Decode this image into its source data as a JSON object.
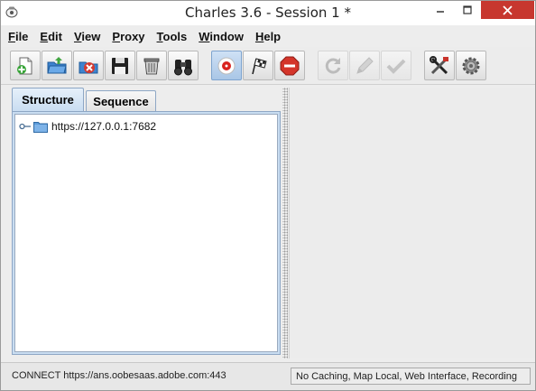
{
  "window": {
    "title": "Charles 3.6 - Session 1 *"
  },
  "menubar": {
    "items": [
      {
        "label": "File",
        "mnemonic": "F",
        "rest": "ile"
      },
      {
        "label": "Edit",
        "mnemonic": "E",
        "rest": "dit"
      },
      {
        "label": "View",
        "mnemonic": "V",
        "rest": "iew"
      },
      {
        "label": "Proxy",
        "mnemonic": "P",
        "rest": "roxy"
      },
      {
        "label": "Tools",
        "mnemonic": "T",
        "rest": "ools"
      },
      {
        "label": "Window",
        "mnemonic": "W",
        "rest": "indow"
      },
      {
        "label": "Help",
        "mnemonic": "H",
        "rest": "elp"
      }
    ]
  },
  "toolbar": {
    "buttons": [
      {
        "icon": "new-session-icon",
        "state": "enabled"
      },
      {
        "icon": "open-folder-icon",
        "state": "enabled"
      },
      {
        "icon": "close-session-icon",
        "state": "enabled"
      },
      {
        "icon": "save-disk-icon",
        "state": "enabled"
      },
      {
        "icon": "trash-can-icon",
        "state": "enabled"
      },
      {
        "icon": "binoculars-icon",
        "state": "enabled"
      },
      {
        "icon": "record-icon",
        "state": "active"
      },
      {
        "icon": "throttle-flag-icon",
        "state": "enabled"
      },
      {
        "icon": "breakpoint-stop-icon",
        "state": "enabled"
      },
      {
        "icon": "repeat-icon",
        "state": "disabled"
      },
      {
        "icon": "edit-pencil-icon",
        "state": "disabled"
      },
      {
        "icon": "validate-check-icon",
        "state": "disabled"
      },
      {
        "icon": "tools-icon",
        "state": "enabled"
      },
      {
        "icon": "settings-gear-icon",
        "state": "enabled"
      }
    ]
  },
  "tabs": [
    {
      "label": "Structure",
      "selected": true
    },
    {
      "label": "Sequence",
      "selected": false
    }
  ],
  "tree": {
    "items": [
      {
        "label": "https://127.0.0.1:7682",
        "icon": "folder-icon"
      }
    ]
  },
  "statusbar": {
    "left": "CONNECT https://ans.oobesaas.adobe.com:443",
    "right": "No Caching, Map Local, Web Interface, Recording"
  },
  "colors": {
    "close_button": "#c7372f",
    "tab_selected": "#c9ddf1",
    "record_red": "#d9231f"
  }
}
